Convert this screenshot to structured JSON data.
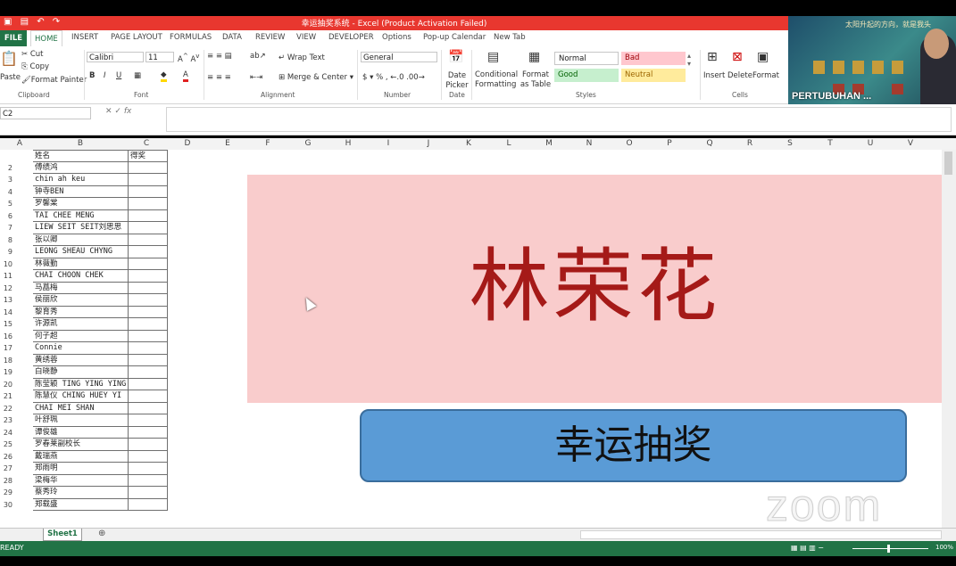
{
  "window": {
    "title": "幸运抽奖系统 - Excel (Product Activation Failed)"
  },
  "ribbon": {
    "tabs": [
      "FILE",
      "HOME",
      "INSERT",
      "PAGE LAYOUT",
      "FORMULAS",
      "DATA",
      "REVIEW",
      "VIEW",
      "DEVELOPER",
      "Options",
      "Pop-up Calendar",
      "New Tab"
    ],
    "clipboard": {
      "cut": "Cut",
      "copy": "Copy",
      "paste": "Paste",
      "format_painter": "Format Painter",
      "label": "Clipboard"
    },
    "font": {
      "name": "Calibri",
      "size": "11",
      "label": "Font"
    },
    "alignment": {
      "wrap": "Wrap Text",
      "merge": "Merge & Center",
      "label": "Alignment"
    },
    "number": {
      "format": "General",
      "label": "Number"
    },
    "date": {
      "picker": "Date Picker",
      "label": "Date"
    },
    "styles": {
      "conditional": "Conditional Formatting",
      "format_table": "Format as Table",
      "normal": "Normal",
      "bad": "Bad",
      "good": "Good",
      "neutral": "Neutral",
      "label": "Styles"
    },
    "cells": {
      "insert": "Insert",
      "delete": "Delete",
      "format": "Format",
      "label": "Cells"
    }
  },
  "formula_bar": {
    "name_box": "C2",
    "fx": "fx"
  },
  "columns": [
    "A",
    "B",
    "C",
    "D",
    "E",
    "F",
    "G",
    "H",
    "I",
    "J",
    "K",
    "L",
    "M",
    "N",
    "O",
    "P",
    "Q",
    "R",
    "S",
    "T",
    "U",
    "V"
  ],
  "table": {
    "header_name": "姓名",
    "header_prize": "得奖",
    "rows": [
      {
        "n": "2",
        "name": "傅绩鸿"
      },
      {
        "n": "3",
        "name": "chin ah keu"
      },
      {
        "n": "4",
        "name": "钟寺BEN"
      },
      {
        "n": "5",
        "name": "罗馨棠"
      },
      {
        "n": "6",
        "name": "TAI CHEE MENG"
      },
      {
        "n": "7",
        "name": "LIEW SEIT SEIT刘思思"
      },
      {
        "n": "8",
        "name": "张以卿"
      },
      {
        "n": "9",
        "name": "LEONG SHEAU CHYNG"
      },
      {
        "n": "10",
        "name": "林薇勤"
      },
      {
        "n": "11",
        "name": "CHAI CHOON CHEK"
      },
      {
        "n": "12",
        "name": "马蕌梅"
      },
      {
        "n": "13",
        "name": "侯丽欣"
      },
      {
        "n": "14",
        "name": "黎育秀"
      },
      {
        "n": "15",
        "name": "许源凯"
      },
      {
        "n": "16",
        "name": "何子超"
      },
      {
        "n": "17",
        "name": "Connie"
      },
      {
        "n": "18",
        "name": "黄绣蓉"
      },
      {
        "n": "19",
        "name": "白晓静"
      },
      {
        "n": "20",
        "name": "陈莹颖 TING YING YING"
      },
      {
        "n": "21",
        "name": "陈慧仪 CHING HUEY YI"
      },
      {
        "n": "22",
        "name": "CHAI MEI SHAN"
      },
      {
        "n": "23",
        "name": "叶舒珮"
      },
      {
        "n": "24",
        "name": "谭俊雄"
      },
      {
        "n": "25",
        "name": "罗春莱副校长"
      },
      {
        "n": "26",
        "name": "戴瑞燕"
      },
      {
        "n": "27",
        "name": "郑雨明"
      },
      {
        "n": "28",
        "name": "梁梅华"
      },
      {
        "n": "29",
        "name": "蔡秀玲"
      },
      {
        "n": "30",
        "name": "郑载盛"
      }
    ]
  },
  "winner": {
    "name": "林荣花"
  },
  "draw_button": {
    "label": "幸运抽奖"
  },
  "zoom": {
    "participant": "PERTUBUHAN ...",
    "background_text": "太阳升起的方向，就是我头",
    "watermark": "zoom",
    "zoom_level": "100%"
  },
  "sheet": {
    "tab": "Sheet1",
    "status": "READY"
  }
}
